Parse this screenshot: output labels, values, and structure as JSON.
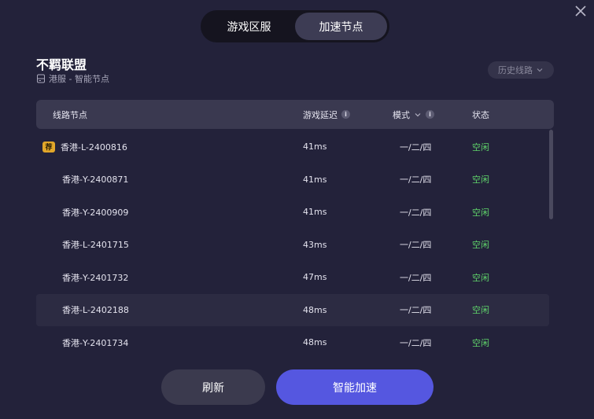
{
  "tabs": [
    {
      "label": "游戏区服",
      "active": false
    },
    {
      "label": "加速节点",
      "active": true
    }
  ],
  "game": {
    "title": "不羁联盟",
    "subtitle": "港服 - 智能节点"
  },
  "history_button": {
    "label": "历史线路"
  },
  "table": {
    "headers": {
      "node": "线路节点",
      "latency": "游戏延迟",
      "mode": "模式",
      "status": "状态"
    },
    "rows": [
      {
        "badge": "荐",
        "name": "香港-L-2400816",
        "latency": "41ms",
        "mode": "一/二/四",
        "status": "空闲"
      },
      {
        "badge": "",
        "name": "香港-Y-2400871",
        "latency": "41ms",
        "mode": "一/二/四",
        "status": "空闲"
      },
      {
        "badge": "",
        "name": "香港-Y-2400909",
        "latency": "41ms",
        "mode": "一/二/四",
        "status": "空闲"
      },
      {
        "badge": "",
        "name": "香港-L-2401715",
        "latency": "43ms",
        "mode": "一/二/四",
        "status": "空闲"
      },
      {
        "badge": "",
        "name": "香港-Y-2401732",
        "latency": "47ms",
        "mode": "一/二/四",
        "status": "空闲"
      },
      {
        "badge": "",
        "name": "香港-L-2402188",
        "latency": "48ms",
        "mode": "一/二/四",
        "status": "空闲"
      },
      {
        "badge": "",
        "name": "香港-Y-2401734",
        "latency": "48ms",
        "mode": "一/二/四",
        "status": "空闲"
      }
    ]
  },
  "buttons": {
    "refresh": "刷新",
    "smart_accelerate": "智能加速"
  },
  "colors": {
    "background": "#23223a",
    "accent": "#5557e0",
    "status_idle": "#5fd36a",
    "badge": "#e2a72a"
  },
  "icons": {
    "close": "close-icon",
    "server": "server-icon",
    "history_chevron": "chevron-down-icon",
    "info": "info-icon"
  }
}
